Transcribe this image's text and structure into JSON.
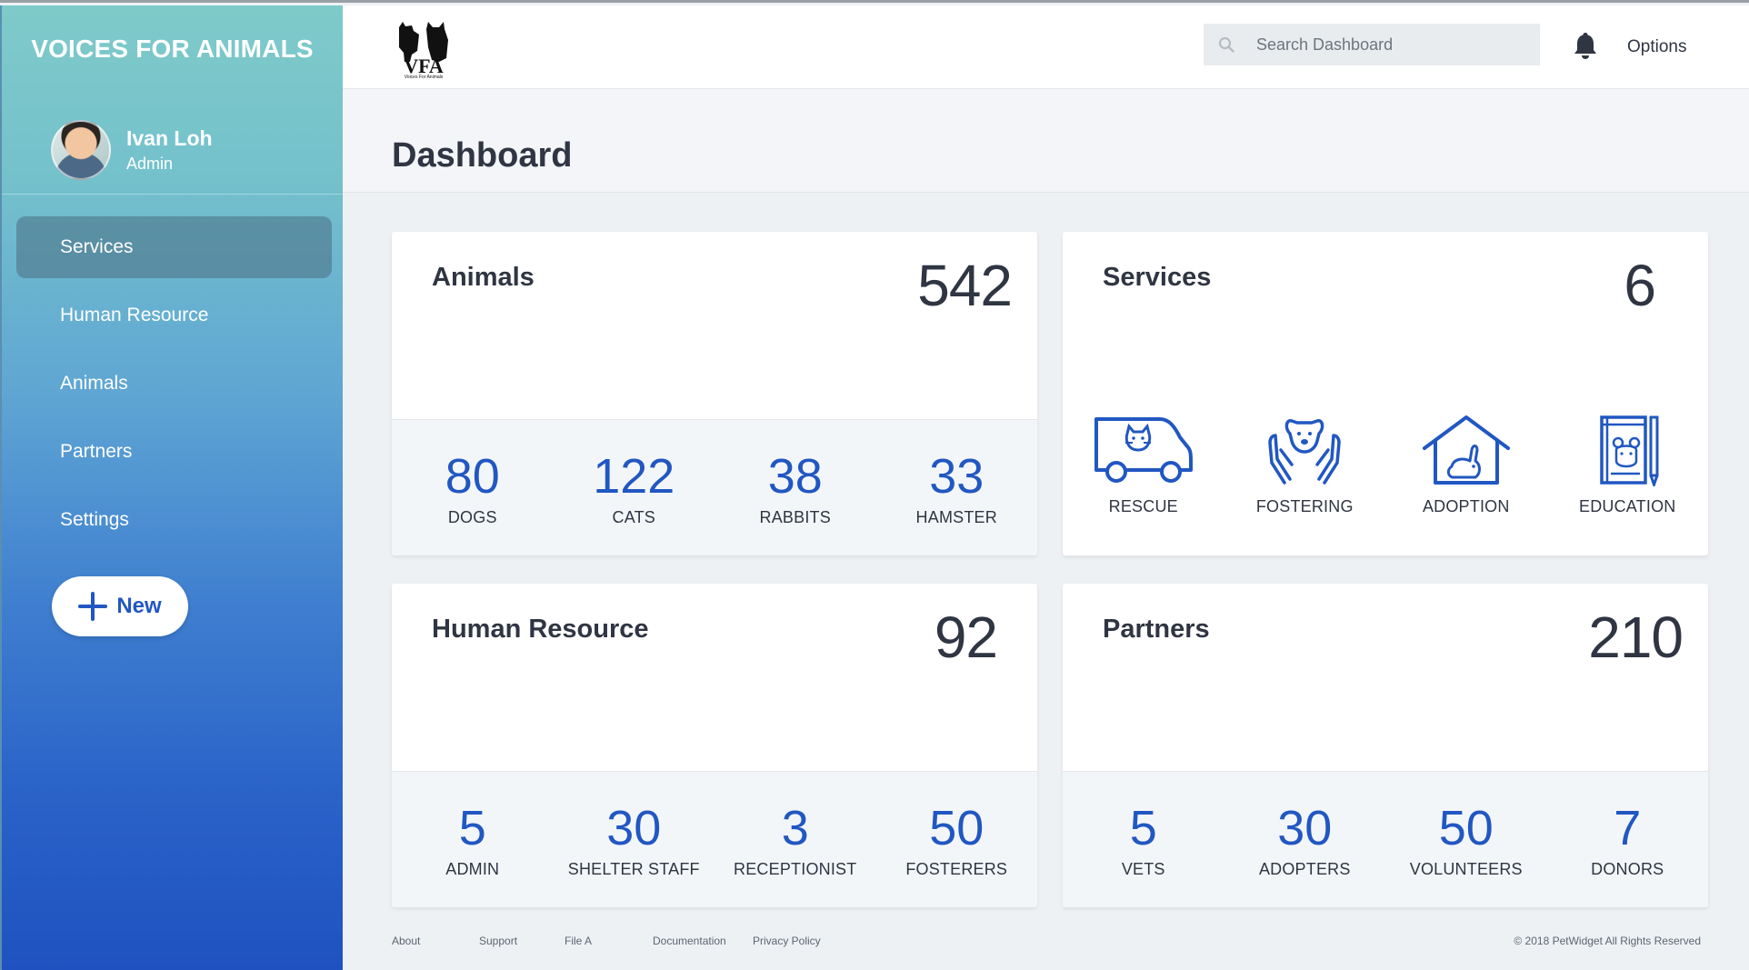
{
  "sidebar": {
    "brand": "VOICES FOR ANIMALS",
    "user": {
      "name": "Ivan Loh",
      "role": "Admin"
    },
    "nav": [
      {
        "label": "Services",
        "active": true
      },
      {
        "label": "Human Resource",
        "active": false
      },
      {
        "label": "Animals",
        "active": false
      },
      {
        "label": "Partners",
        "active": false
      },
      {
        "label": "Settings",
        "active": false
      }
    ],
    "new_button": "New"
  },
  "topbar": {
    "logo_letters": "VFA",
    "logo_caption": "Voices For Animals",
    "search_placeholder": "Search Dashboard",
    "options_label": "Options"
  },
  "page": {
    "title": "Dashboard"
  },
  "cards": {
    "animals": {
      "title": "Animals",
      "total": "542",
      "stats": [
        {
          "value": "80",
          "label": "DOGS"
        },
        {
          "value": "122",
          "label": "CATS"
        },
        {
          "value": "38",
          "label": "RABBITS"
        },
        {
          "value": "33",
          "label": "HAMSTER"
        }
      ]
    },
    "services": {
      "title": "Services",
      "total": "6",
      "items": [
        {
          "label": "RESCUE",
          "icon": "rescue-van-icon"
        },
        {
          "label": "FOSTERING",
          "icon": "fostering-hands-icon"
        },
        {
          "label": "ADOPTION",
          "icon": "adoption-house-icon"
        },
        {
          "label": "EDUCATION",
          "icon": "education-book-icon"
        }
      ]
    },
    "human_resource": {
      "title": "Human Resource",
      "total": "92",
      "stats": [
        {
          "value": "5",
          "label": "ADMIN"
        },
        {
          "value": "30",
          "label": "SHELTER STAFF"
        },
        {
          "value": "3",
          "label": "RECEPTIONIST"
        },
        {
          "value": "50",
          "label": "FOSTERERS"
        }
      ]
    },
    "partners": {
      "title": "Partners",
      "total": "210",
      "stats": [
        {
          "value": "5",
          "label": "VETS"
        },
        {
          "value": "30",
          "label": "ADOPTERS"
        },
        {
          "value": "50",
          "label": "VOLUNTEERS"
        },
        {
          "value": "7",
          "label": "DONORS"
        }
      ]
    }
  },
  "footer": {
    "links": [
      "About",
      "Support",
      "File A",
      "Documentation",
      "Privacy Policy"
    ],
    "copyright": "© 2018 PetWidget All Rights Reserved"
  },
  "colors": {
    "accent": "#2157c2",
    "sidebar_top": "#7ecac9",
    "sidebar_bottom": "#1f52c0"
  }
}
